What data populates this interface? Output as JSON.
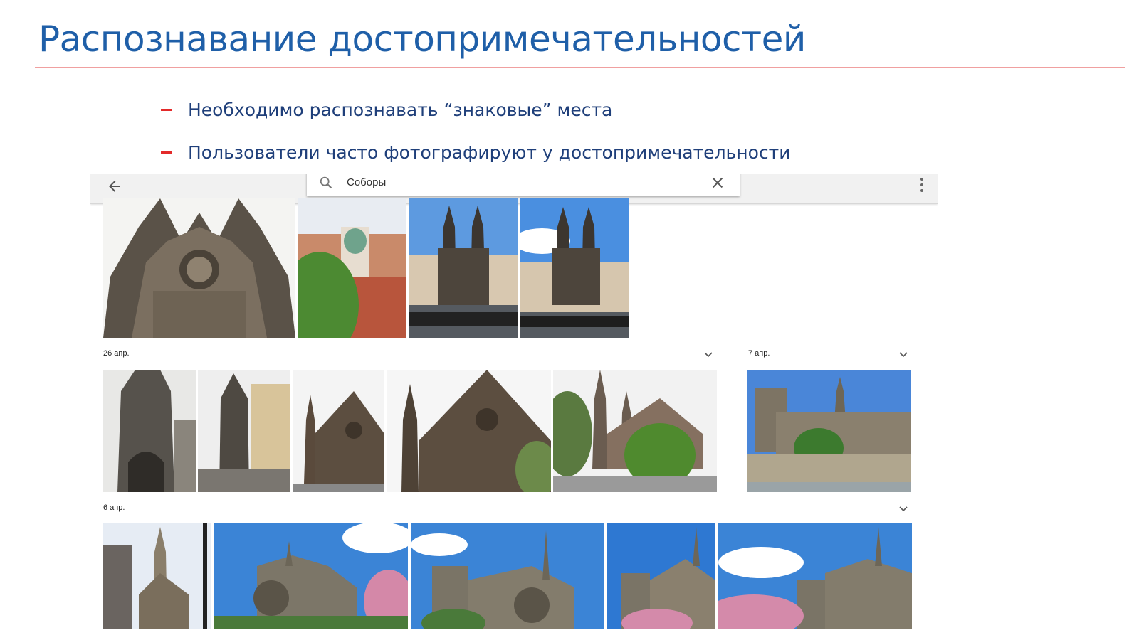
{
  "slide": {
    "title": "Распознавание достопримечательностей",
    "bullets": [
      "Необходимо распознавать “знаковые” места",
      "Пользователи часто фотографируют у достопримечательности"
    ]
  },
  "app": {
    "search": {
      "value": "Соборы"
    },
    "icons": {
      "back": "arrow-back-icon",
      "search": "search-icon",
      "clear": "close-icon",
      "more": "more-vert-icon",
      "expand": "chevron-down-icon"
    },
    "groups": [
      {
        "date": "26 апр."
      },
      {
        "date": "7 апр."
      },
      {
        "date": "6 апр."
      }
    ]
  },
  "colors": {
    "title": "#1f5fa8",
    "bullet_text": "#1f3f7a",
    "dash": "#e32a2a",
    "rule": "#f0a0a0",
    "sky": "#3b84d6"
  }
}
